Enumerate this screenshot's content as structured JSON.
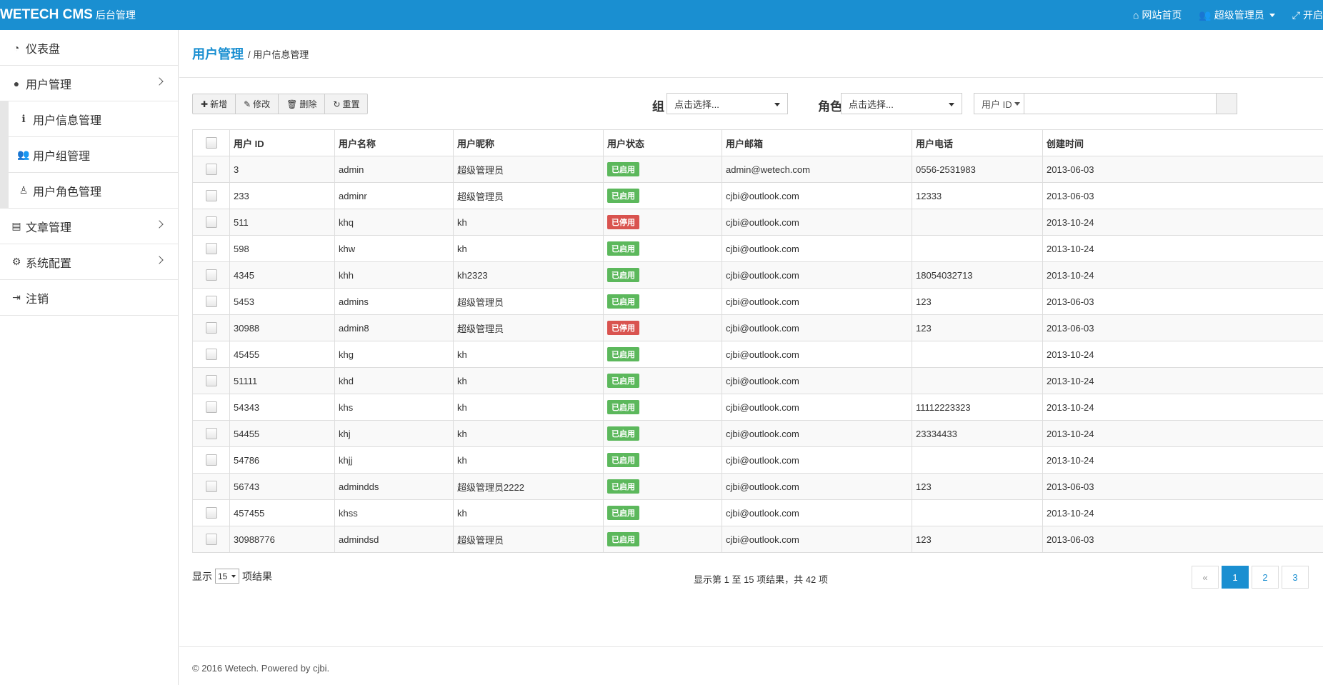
{
  "navbar": {
    "brand": "WETECH CMS",
    "brand_sub": "后台管理",
    "home_label": "网站首页",
    "user_label": "超级管理员",
    "extra_label": "开启"
  },
  "sidebar": {
    "items": [
      {
        "label": "仪表盘",
        "icon": "dashboard-icon"
      },
      {
        "label": "用户管理",
        "icon": "user-icon"
      },
      {
        "label": "文章管理",
        "icon": "file-icon"
      },
      {
        "label": "系统配置",
        "icon": "gears-icon"
      },
      {
        "label": "注销",
        "icon": "sign-out-icon"
      }
    ],
    "sub_items": [
      {
        "label": "用户信息管理",
        "icon": "info-icon"
      },
      {
        "label": "用户组管理",
        "icon": "users-icon"
      },
      {
        "label": "用户角色管理",
        "icon": "role-icon"
      }
    ]
  },
  "header": {
    "title": "用户管理",
    "crumb": "/ 用户信息管理"
  },
  "toolbar": {
    "add": "新增",
    "edit": "修改",
    "delete": "删除",
    "reset": "重置",
    "group_label": "组",
    "group_placeholder": "点击选择...",
    "role_label": "角色",
    "role_placeholder": "点击选择...",
    "search_field": "用户 ID"
  },
  "table": {
    "columns": [
      "用户 ID",
      "用户名称",
      "用户昵称",
      "用户状态",
      "用户邮箱",
      "用户电话",
      "创建时间"
    ],
    "rows": [
      {
        "id": "3",
        "name": "admin",
        "nick": "超级管理员",
        "status": "已启用",
        "enabled": true,
        "email": "admin@wetech.com",
        "phone": "0556-2531983",
        "created": "2013-06-03"
      },
      {
        "id": "233",
        "name": "adminr",
        "nick": "超级管理员",
        "status": "已启用",
        "enabled": true,
        "email": "cjbi@outlook.com",
        "phone": "12333",
        "created": "2013-06-03"
      },
      {
        "id": "511",
        "name": "khq",
        "nick": "kh",
        "status": "已停用",
        "enabled": false,
        "email": "cjbi@outlook.com",
        "phone": "",
        "created": "2013-10-24"
      },
      {
        "id": "598",
        "name": "khw",
        "nick": "kh",
        "status": "已启用",
        "enabled": true,
        "email": "cjbi@outlook.com",
        "phone": "",
        "created": "2013-10-24"
      },
      {
        "id": "4345",
        "name": "khh",
        "nick": "kh2323",
        "status": "已启用",
        "enabled": true,
        "email": "cjbi@outlook.com",
        "phone": "18054032713",
        "created": "2013-10-24"
      },
      {
        "id": "5453",
        "name": "admins",
        "nick": "超级管理员",
        "status": "已启用",
        "enabled": true,
        "email": "cjbi@outlook.com",
        "phone": "123",
        "created": "2013-06-03"
      },
      {
        "id": "30988",
        "name": "admin8",
        "nick": "超级管理员",
        "status": "已停用",
        "enabled": false,
        "email": "cjbi@outlook.com",
        "phone": "123",
        "created": "2013-06-03"
      },
      {
        "id": "45455",
        "name": "khg",
        "nick": "kh",
        "status": "已启用",
        "enabled": true,
        "email": "cjbi@outlook.com",
        "phone": "",
        "created": "2013-10-24"
      },
      {
        "id": "51111",
        "name": "khd",
        "nick": "kh",
        "status": "已启用",
        "enabled": true,
        "email": "cjbi@outlook.com",
        "phone": "",
        "created": "2013-10-24"
      },
      {
        "id": "54343",
        "name": "khs",
        "nick": "kh",
        "status": "已启用",
        "enabled": true,
        "email": "cjbi@outlook.com",
        "phone": "11112223323",
        "created": "2013-10-24"
      },
      {
        "id": "54455",
        "name": "khj",
        "nick": "kh",
        "status": "已启用",
        "enabled": true,
        "email": "cjbi@outlook.com",
        "phone": "23334433",
        "created": "2013-10-24"
      },
      {
        "id": "54786",
        "name": "khjj",
        "nick": "kh",
        "status": "已启用",
        "enabled": true,
        "email": "cjbi@outlook.com",
        "phone": "",
        "created": "2013-10-24"
      },
      {
        "id": "56743",
        "name": "admindds",
        "nick": "超级管理员2222",
        "status": "已启用",
        "enabled": true,
        "email": "cjbi@outlook.com",
        "phone": "123",
        "created": "2013-06-03"
      },
      {
        "id": "457455",
        "name": "khss",
        "nick": "kh",
        "status": "已启用",
        "enabled": true,
        "email": "cjbi@outlook.com",
        "phone": "",
        "created": "2013-10-24"
      },
      {
        "id": "30988776",
        "name": "admindsd",
        "nick": "超级管理员",
        "status": "已启用",
        "enabled": true,
        "email": "cjbi@outlook.com",
        "phone": "123",
        "created": "2013-06-03"
      }
    ]
  },
  "paging": {
    "show_prefix": "显示",
    "page_size": "15",
    "show_suffix": "项结果",
    "info": "显示第 1 至 15 项结果，共 42 项",
    "prev": "«",
    "pages": [
      "1",
      "2",
      "3"
    ],
    "current": "1"
  },
  "footer": {
    "text": "© 2016 Wetech. Powered by cjbi."
  },
  "colors": {
    "brand": "#1a8fd1",
    "enabled": "#5cb85c",
    "disabled": "#d9534f"
  }
}
